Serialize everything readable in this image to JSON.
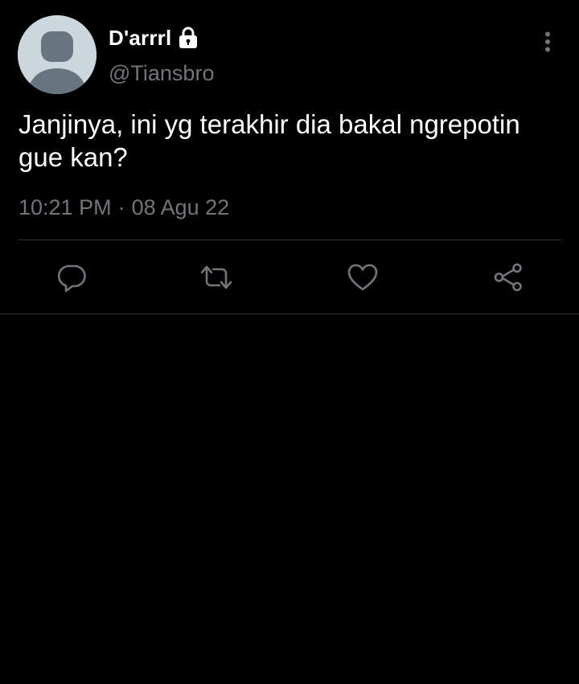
{
  "tweet": {
    "display_name": "D'arrrl",
    "handle": "@Tiansbro",
    "text": "Janjinya, ini yg terakhir dia bakal ngrepotin gue kan?",
    "time": "10:21 PM",
    "separator": "·",
    "date": "08 Agu 22",
    "protected": true
  },
  "icons": {
    "avatar": "default-avatar-icon",
    "lock": "lock-icon",
    "more": "more-vertical-icon",
    "reply": "reply-icon",
    "retweet": "retweet-icon",
    "like": "heart-icon",
    "share": "share-icon"
  },
  "colors": {
    "background": "#000000",
    "text_primary": "#ffffff",
    "text_secondary": "#71767b",
    "divider": "#2f3336",
    "avatar_bg": "#ccd6dd",
    "avatar_fg": "#66757f"
  }
}
